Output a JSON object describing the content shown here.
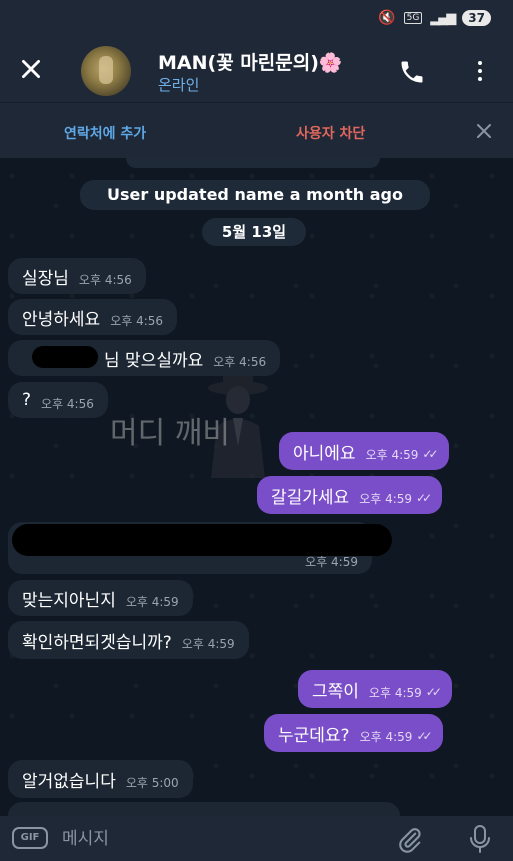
{
  "status_bar": {
    "network": "5G",
    "battery": "37"
  },
  "header": {
    "contact_name": "MAN(꽃 마린문의)🌸",
    "contact_status": "온라인"
  },
  "actions": {
    "add_contact": "연락처에 추가",
    "block_user": "사용자 차단"
  },
  "chat": {
    "system_message": "User updated name a month ago",
    "date_label": "5월 13일",
    "messages": [
      {
        "text": "실장님",
        "time": "오후 4:56"
      },
      {
        "text": "안녕하세요",
        "time": "오후 4:56"
      },
      {
        "text": "님 맞으실까요",
        "time": "오후 4:56"
      },
      {
        "text": "?",
        "time": "오후 4:56"
      },
      {
        "text": "아니에요",
        "time": "오후 4:59"
      },
      {
        "text": "갈길가세요",
        "time": "오후 4:59"
      },
      {
        "text": "",
        "time": "오후 4:59"
      },
      {
        "text": "맞는지아닌지",
        "time": "오후 4:59"
      },
      {
        "text": "확인하면되겟습니까?",
        "time": "오후 4:59"
      },
      {
        "text": "그쪽이",
        "time": "오후 4:59"
      },
      {
        "text": "누군데요?",
        "time": "오후 4:59"
      },
      {
        "text": "알거없습니다",
        "time": "오후 5:00"
      }
    ],
    "watermark_text": "머디 깨비"
  },
  "composer": {
    "gif_label": "GIF",
    "placeholder": "메시지"
  },
  "colors": {
    "outgoing_bubble": "#7a4ec8",
    "incoming_bubble": "#1c2733",
    "accent": "#5fa8e6",
    "danger": "#e0675d"
  }
}
